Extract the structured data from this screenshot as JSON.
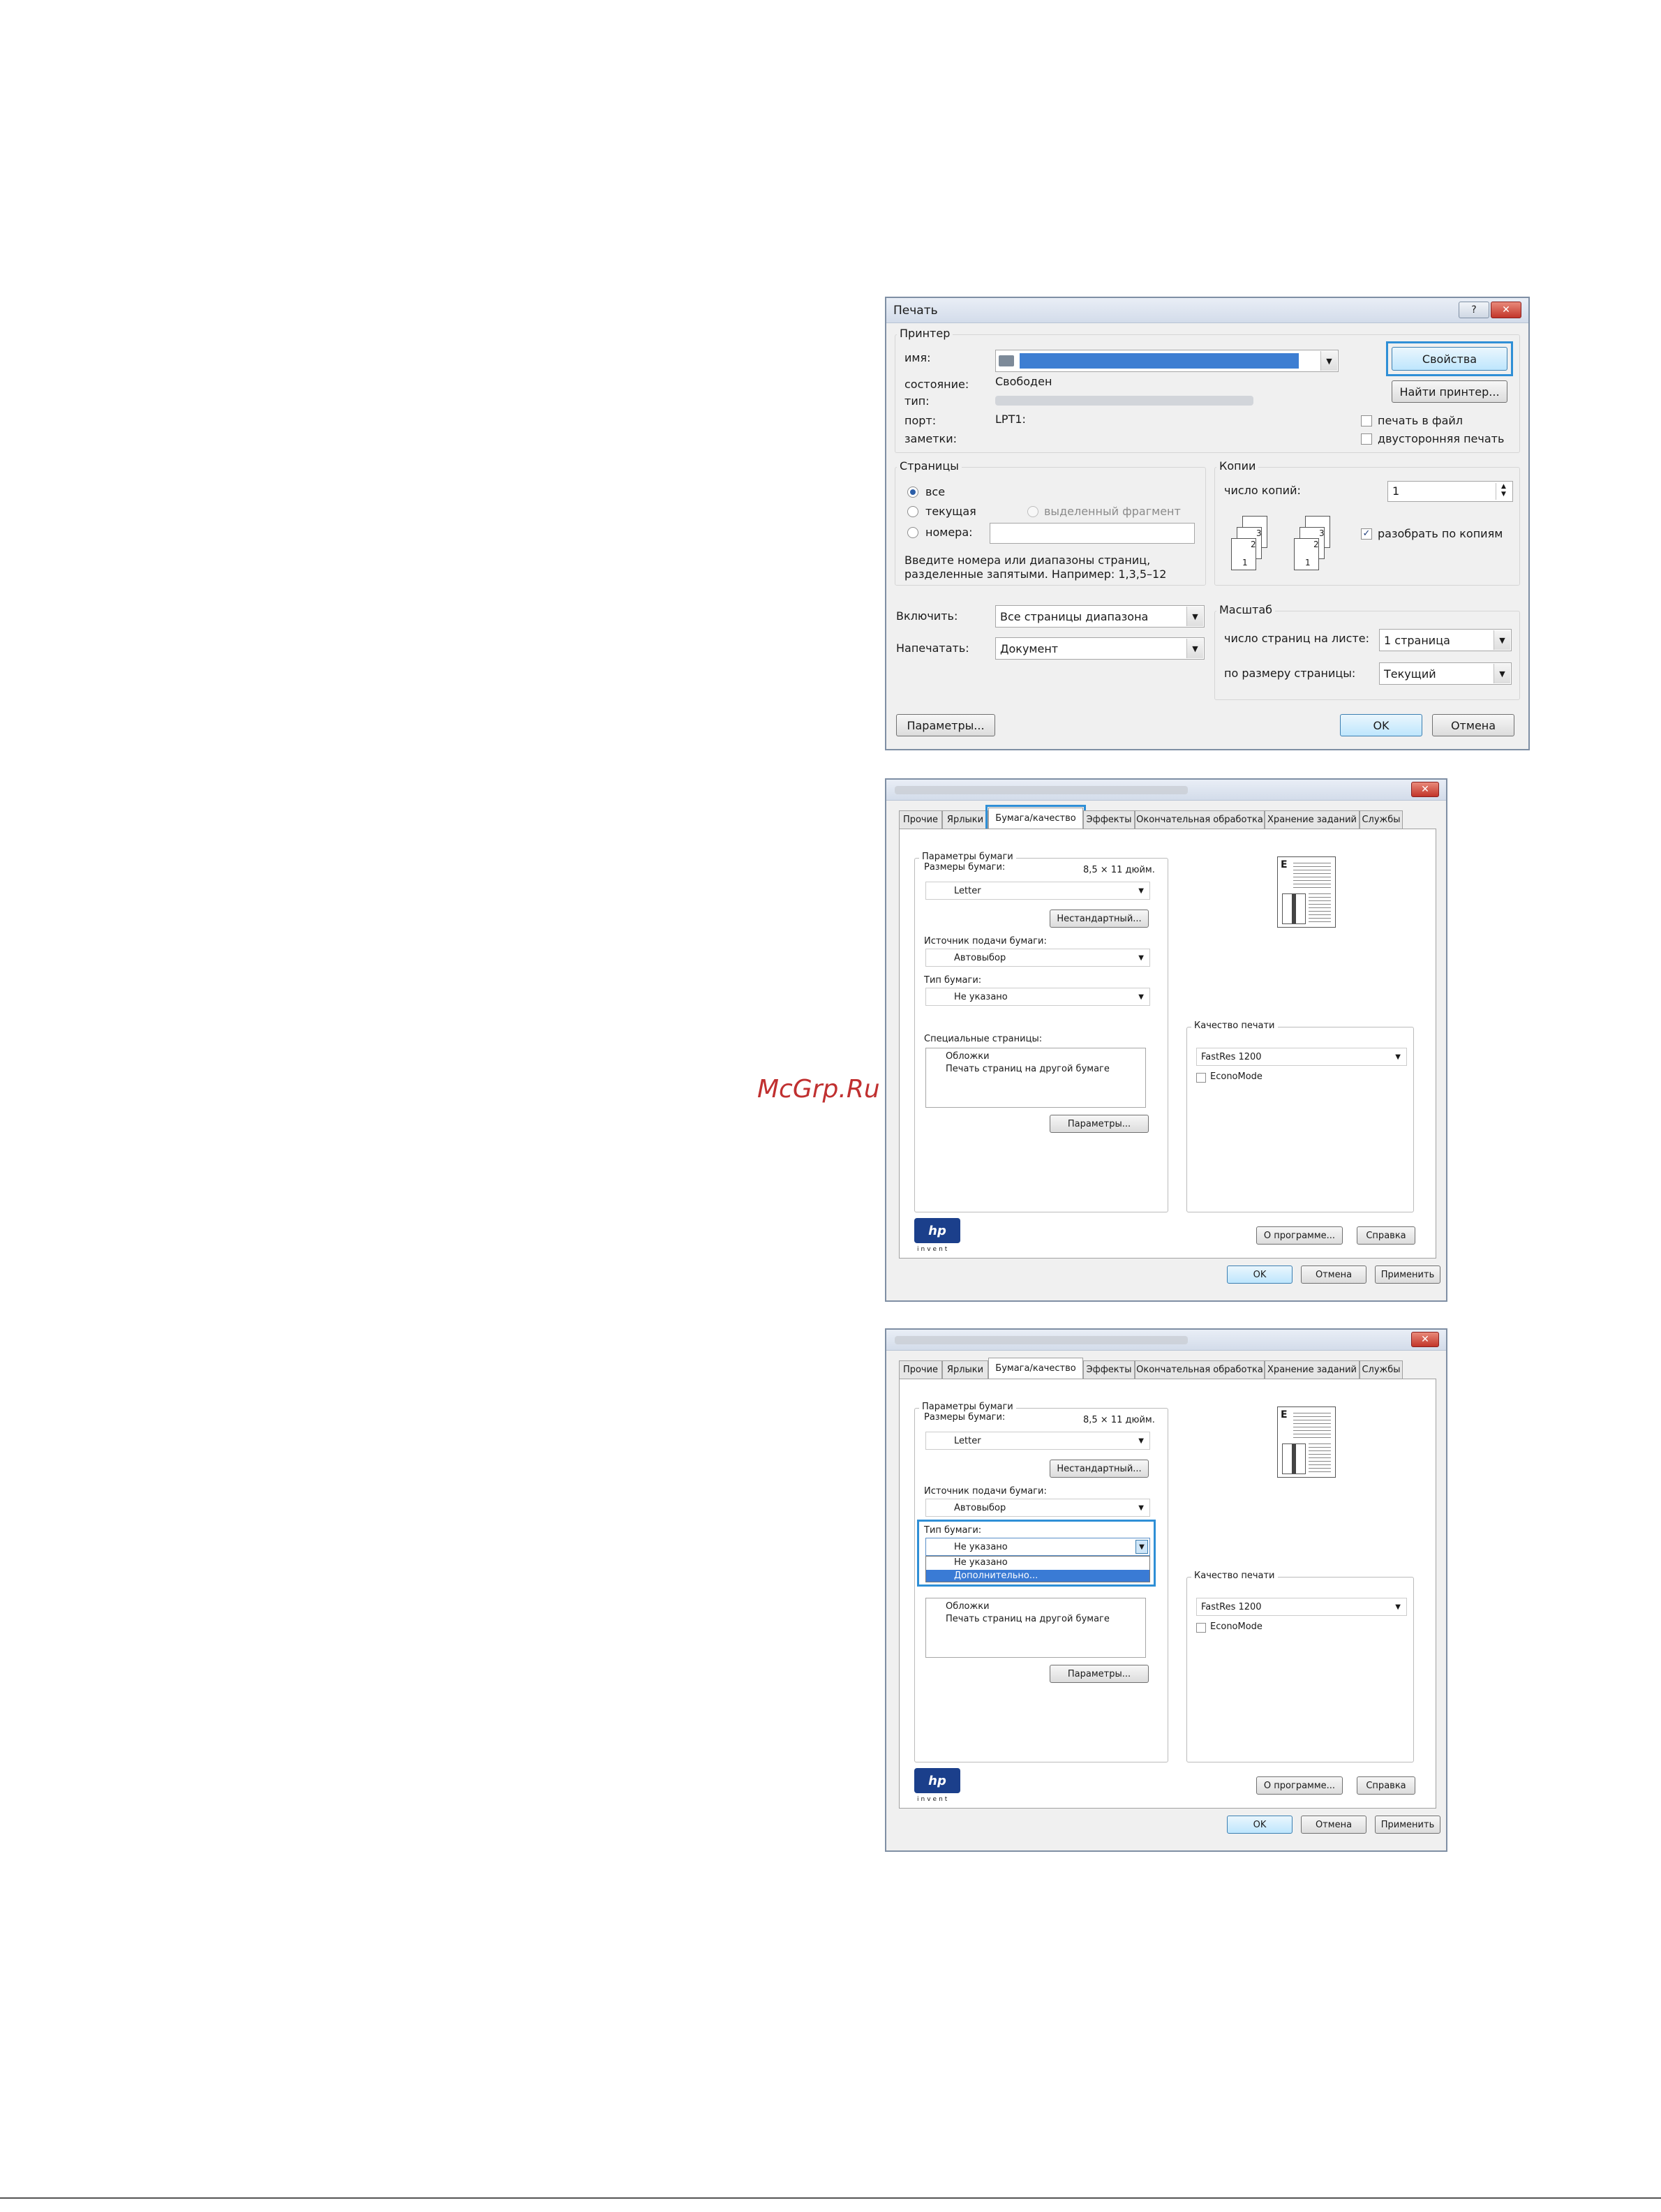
{
  "watermark": "McGrp.Ru",
  "print_dialog": {
    "title": "Печать",
    "help_label": "?",
    "close_label": "✕",
    "printer": {
      "legend": "Принтер",
      "name_label": "имя:",
      "status_label": "состояние:",
      "status_value": "Свободен",
      "type_label": "тип:",
      "port_label": "порт:",
      "port_value": "LPT1:",
      "notes_label": "заметки:",
      "properties_button": "Свойства",
      "find_printer_button": "Найти принтер...",
      "print_to_file": "печать в файл",
      "duplex": "двусторонняя печать"
    },
    "pages": {
      "legend": "Страницы",
      "all": "все",
      "current": "текущая",
      "selection": "выделенный фрагмент",
      "numbers": "номера:",
      "hint_line1": "Введите номера или диапазоны страниц,",
      "hint_line2": "разделенные запятыми. Например: 1,3,5–12"
    },
    "copies": {
      "legend": "Копии",
      "count_label": "число копий:",
      "count_value": "1",
      "collate": "разобрать по копиям",
      "page_nums": [
        "1",
        "2",
        "3"
      ]
    },
    "include_label": "Включить:",
    "include_value": "Все страницы диапазона",
    "print_what_label": "Напечатать:",
    "print_what_value": "Документ",
    "scale": {
      "legend": "Масштаб",
      "pages_per_sheet_label": "число страниц на листе:",
      "pages_per_sheet_value": "1 страница",
      "fit_label": "по размеру страницы:",
      "fit_value": "Текущий"
    },
    "params_button": "Параметры...",
    "ok_button": "OK",
    "cancel_button": "Отмена"
  },
  "props_dialog": {
    "close_label": "✕",
    "tabs": [
      "Прочие",
      "Ярлыки",
      "Бумага/качество",
      "Эффекты",
      "Окончательная обработка",
      "Хранение заданий",
      "Службы"
    ],
    "paper_group": "Параметры бумаги",
    "size_label": "Размеры бумаги:",
    "size_value": "8,5 × 11 дюйм.",
    "size_select": "Letter",
    "custom_button": "Нестандартный...",
    "source_label": "Источник подачи бумаги:",
    "source_select": "Автовыбор",
    "type_label": "Тип бумаги:",
    "type_select": "Не указано",
    "type_options": [
      "Не указано",
      "Дополнительно..."
    ],
    "special_label": "Специальные страницы:",
    "special_items": [
      "Обложки",
      "Печать страниц на другой бумаге"
    ],
    "special_params_button": "Параметры...",
    "preview_letter": "E",
    "quality_group": "Качество печати",
    "quality_select": "FastRes 1200",
    "economode": "EconoMode",
    "logo_text": "hp",
    "logo_sub": "invent",
    "about_button": "О программе...",
    "help_button": "Справка",
    "ok_button": "OK",
    "cancel_button": "Отмена",
    "apply_button": "Применить"
  }
}
